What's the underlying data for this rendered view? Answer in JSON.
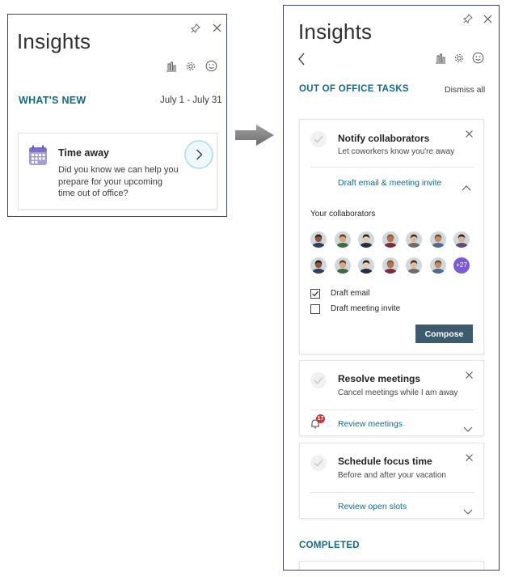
{
  "left": {
    "title": "Insights",
    "section": "WHAT'S NEW",
    "date_range": "July 1 - July 31",
    "card": {
      "title": "Time away",
      "body_lines": [
        "Did you know we can help you",
        "prepare for your upcoming",
        "time out of office?"
      ]
    },
    "icons": {
      "pin": "pin-icon",
      "close": "close-icon",
      "chart": "bar-chart-icon",
      "settings": "gear-icon",
      "feedback": "smiley-icon",
      "calendar": "calendar-icon",
      "next": "chevron-right-icon"
    }
  },
  "right": {
    "title": "Insights",
    "section": "OUT OF OFFICE TASKS",
    "dismiss_all": "Dismiss all",
    "tasks": [
      {
        "title": "Notify collaborators",
        "subtitle": "Let coworkers know you're away",
        "link": "Draft email & meeting invite",
        "expanded": true
      },
      {
        "title": "Resolve meetings",
        "subtitle": "Cancel meetings while I am away",
        "link": "Review meetings",
        "badge": "17"
      },
      {
        "title": "Schedule focus time",
        "subtitle": "Before and after your vacation",
        "link": "Review open slots"
      }
    ],
    "collaborators_label": "Your collaborators",
    "collaborators_more": "+27",
    "checkboxes": [
      {
        "label": "Draft email",
        "checked": true
      },
      {
        "label": "Draft meeting invite",
        "checked": false
      }
    ],
    "compose": "Compose",
    "completed": "COMPLETED"
  },
  "colors": {
    "panel_border": "#3f4270",
    "accent": "#0f6c86",
    "button": "#3d5b6e",
    "badge": "#d13438",
    "more_avatar": "#7b5bd6",
    "arrow": "#7f7f7f"
  }
}
